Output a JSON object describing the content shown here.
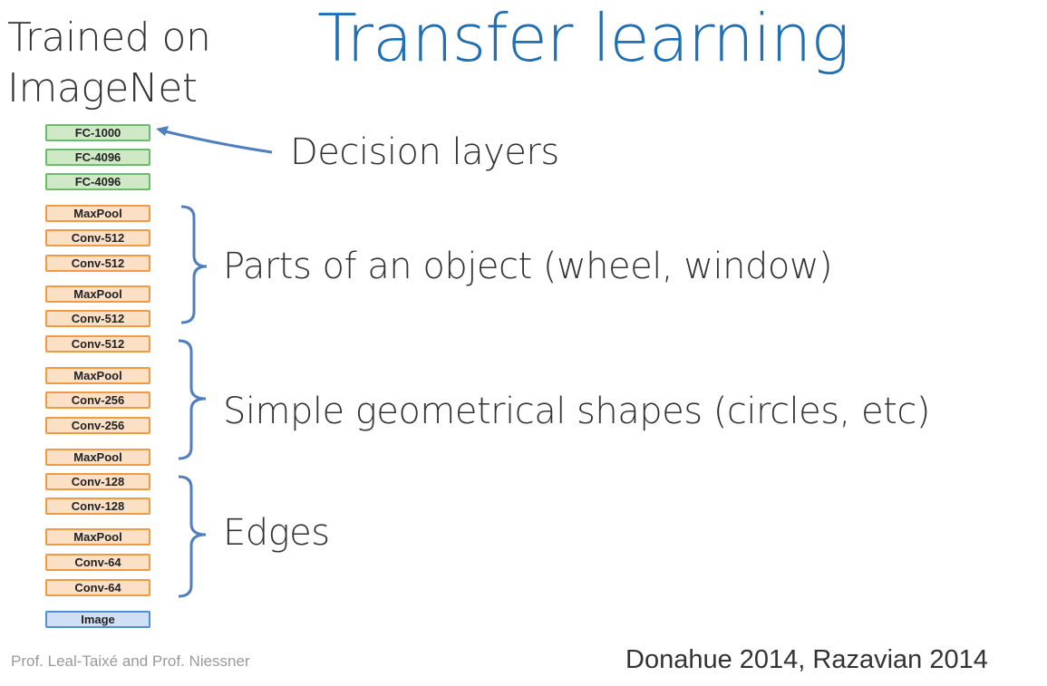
{
  "title": "Transfer learning",
  "trained_line1": "Trained on",
  "trained_line2": "ImageNet",
  "layers": {
    "fc1000": "FC-1000",
    "fc4096a": "FC-4096",
    "fc4096b": "FC-4096",
    "maxpool1": "MaxPool",
    "conv512a": "Conv-512",
    "conv512b": "Conv-512",
    "maxpool2": "MaxPool",
    "conv512c": "Conv-512",
    "conv512d": "Conv-512",
    "maxpool3": "MaxPool",
    "conv256a": "Conv-256",
    "conv256b": "Conv-256",
    "maxpool4": "MaxPool",
    "conv128a": "Conv-128",
    "conv128b": "Conv-128",
    "maxpool5": "MaxPool",
    "conv64a": "Conv-64",
    "conv64b": "Conv-64",
    "image": "Image"
  },
  "annotations": {
    "decision": "Decision layers",
    "parts": "Parts of an object (wheel, window)",
    "shapes": "Simple geometrical shapes (circles, etc)",
    "edges": "Edges"
  },
  "footer": {
    "credit": "Prof. Leal-Taixé and Prof. Niessner",
    "citation": "Donahue 2014, Razavian 2014"
  },
  "colors": {
    "title": "#1f6fb2",
    "fc_fill": "#cfe8c6",
    "conv_fill": "#fbe0c6",
    "image_fill": "#cfe0f5",
    "bracket": "#4f7fbf"
  }
}
